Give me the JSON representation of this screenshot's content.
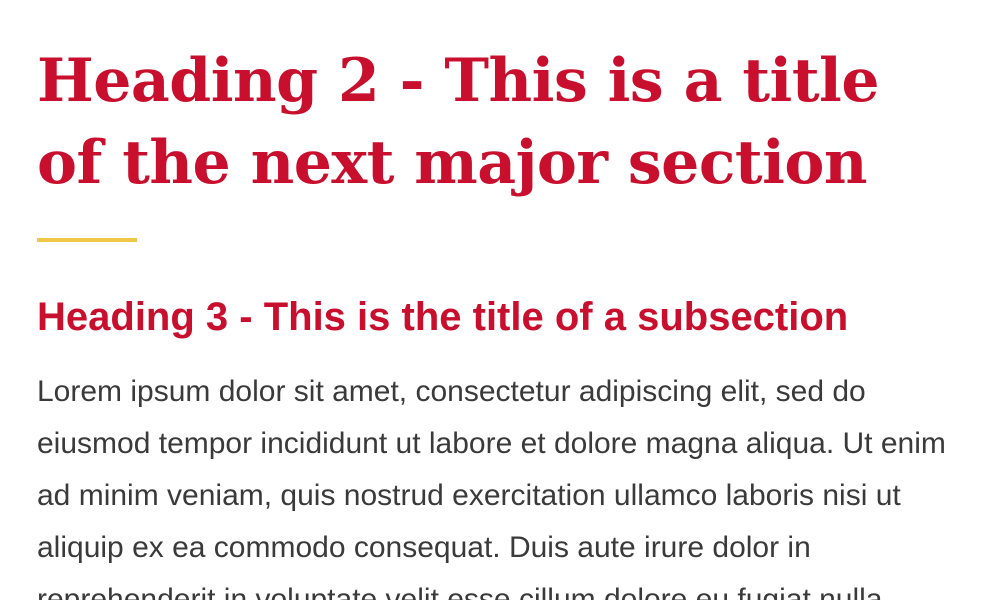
{
  "heading2": "Heading 2 - This is a title of the next major section",
  "heading3": "Heading 3 - This is the title of a subsection",
  "paragraph": "Lorem ipsum dolor sit amet, consectetur adipiscing elit, sed do eiusmod tempor incididunt ut labore et dolore magna aliqua. Ut enim ad minim veniam, quis nostrud exercitation ullamco laboris nisi ut aliquip ex ea commodo consequat. Duis aute irure dolor in reprehenderit in voluptate velit esse cillum dolore eu fugiat nulla",
  "colors": {
    "heading": "#c8102e",
    "accent_rule": "#f1c74a",
    "body_text": "#3a3a3a"
  }
}
